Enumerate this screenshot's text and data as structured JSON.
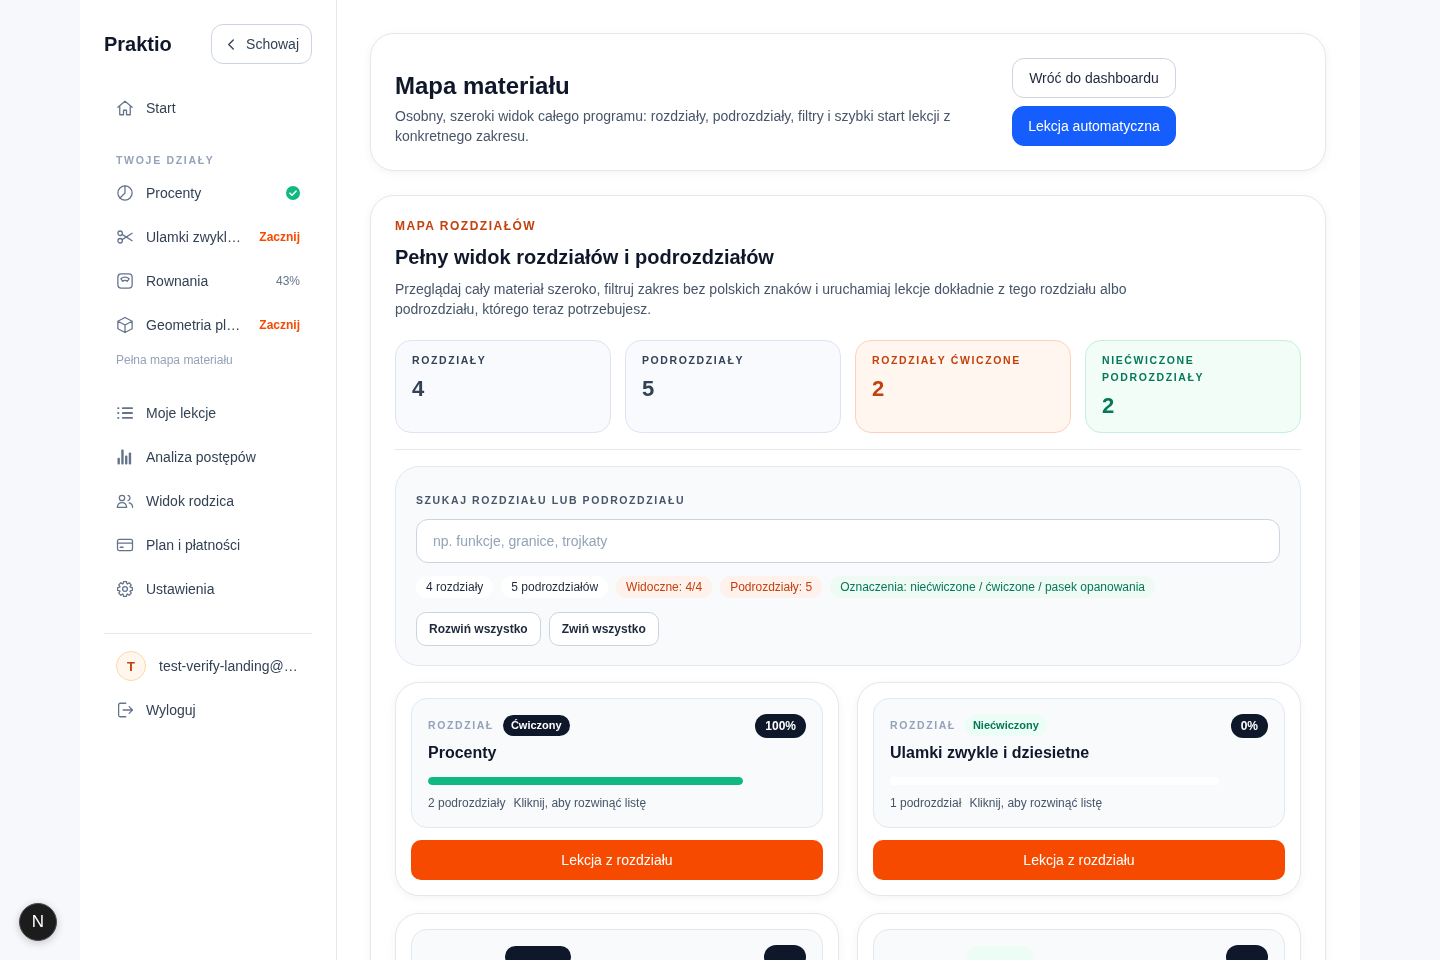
{
  "sidebar": {
    "brand": "Praktio",
    "collapse": "Schowaj",
    "start": {
      "label": "Start",
      "selected": false
    },
    "section_title": "TWOJE DZIAŁY",
    "sections": [
      {
        "label": "Procenty",
        "kind": "done",
        "selected": false
      },
      {
        "label": "Ulamki zwykl…",
        "kind": "start",
        "badge": "Zacznij",
        "selected": false
      },
      {
        "label": "Rownania",
        "kind": "progress",
        "badge": "43%",
        "selected": false
      },
      {
        "label": "Geometria pl…",
        "kind": "start",
        "badge": "Zacznij",
        "selected": false
      }
    ],
    "map_link": "Pełna mapa materiału",
    "nav": [
      {
        "label": "Moje lekcje",
        "selected": false
      },
      {
        "label": "Analiza postępów",
        "selected": false
      },
      {
        "label": "Widok rodzica",
        "selected": false
      },
      {
        "label": "Plan i płatności",
        "selected": false
      },
      {
        "label": "Ustawienia",
        "selected": false
      }
    ],
    "user": {
      "initial": "T",
      "email": "test-verify-landing@…"
    },
    "logout": "Wyloguj"
  },
  "header": {
    "title": "Mapa materiału",
    "description": "Osobny, szeroki widok całego programu: rozdziały, podrozdziały, filtry i szybki start lekcji z konkretnego zakresu.",
    "buttons": [
      {
        "label": "Wróć do dashboardu",
        "kind": "secondary"
      },
      {
        "label": "Lekcja automatyczna",
        "kind": "primary"
      }
    ]
  },
  "chapter_map": {
    "eyebrow": "MAPA ROZDZIAŁÓW",
    "title": "Pełny widok rozdziałów i podrozdziałów",
    "description": "Przeglądaj cały materiał szeroko, filtruj zakres bez polskich znaków i uruchamiaj lekcje dokładnie z tego rozdziału albo podrozdziału, którego teraz potrzebujesz.",
    "stats": [
      {
        "label": "ROZDZIAŁY",
        "value": "4",
        "color": "#334155"
      },
      {
        "label": "PODROZDZIAŁY",
        "value": "5",
        "color": "#334155"
      },
      {
        "label": "ROZDZIAŁY ĆWICZONE",
        "value": "2",
        "color": "#c2410c"
      },
      {
        "label": "NIEĆWICZONE PODROZDZIAŁY",
        "value": "2",
        "color": "#047857"
      }
    ],
    "search": {
      "label": "SZUKAJ ROZDZIAŁU LUB PODROZDZIAŁU",
      "placeholder": "np. funkcje, granice, trojkaty"
    },
    "chips": [
      {
        "text": "4 rozdziały",
        "kind": "count"
      },
      {
        "text": "5 podrozdziałów",
        "kind": "count"
      },
      {
        "text": "Widoczne: 4/4",
        "kind": "tag",
        "color": "#c2410c"
      },
      {
        "text": "Podrozdziały: 5",
        "kind": "tag",
        "color": "#c2410c"
      },
      {
        "text": "Oznaczenia: niećwiczone / ćwiczone / pasek opanowania",
        "kind": "tag",
        "color": "#047857"
      }
    ],
    "actions": [
      "Rozwiń wszystko",
      "Zwiń wszystko"
    ],
    "chapters": [
      {
        "label": "ROZDZIAŁ",
        "status": "Ćwiczony",
        "practiced": true,
        "percent": "100%",
        "title": "Procenty",
        "level": 1,
        "subsections": "2 podrozdziały",
        "hint": "Kliknij, aby rozwinąć listę",
        "button": "Lekcja z rozdziału"
      },
      {
        "label": "ROZDZIAŁ",
        "status": "Niećwiczony",
        "practiced": false,
        "percent": "0%",
        "title": "Ulamki zwykle i dziesietne",
        "level": 0,
        "subsections": "1 podrozdział",
        "hint": "Kliknij, aby rozwinąć listę",
        "button": "Lekcja z rozdziału"
      },
      {
        "practiced": true
      },
      {
        "practiced": false
      }
    ]
  },
  "dev_badge": "N"
}
